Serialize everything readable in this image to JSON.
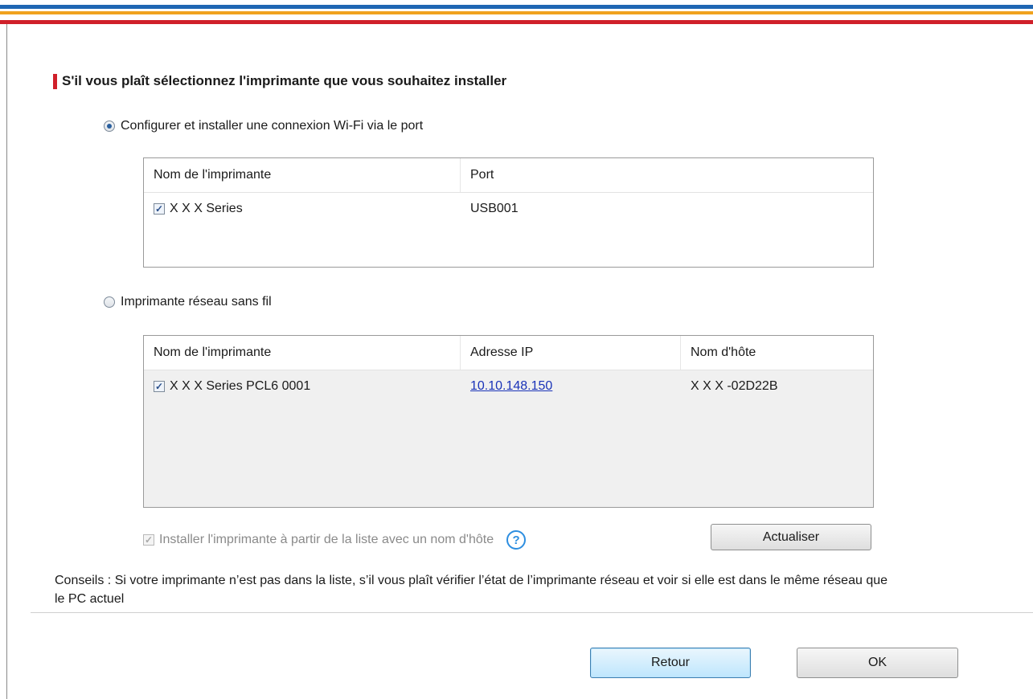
{
  "heading": "S'il vous plaît sélectionnez l'imprimante que vous souhaitez installer",
  "usb_option": {
    "label": "Configurer et installer une connexion Wi-Fi via le port",
    "selected": true,
    "columns": [
      "Nom de l'imprimante",
      "Port"
    ],
    "rows": [
      {
        "checked": true,
        "name": "X X X  Series",
        "port": "USB001"
      }
    ]
  },
  "network_option": {
    "label": "Imprimante réseau sans fil",
    "selected": false,
    "columns": [
      "Nom de l'imprimante",
      "Adresse IP",
      "Nom d'hôte"
    ],
    "rows": [
      {
        "checked": true,
        "name": "X X X  Series PCL6 0001",
        "ip": "10.10.148.150",
        "host": "X X X -02D22B"
      }
    ]
  },
  "install_by_hostname": {
    "label": "Installer l'imprimante à partir de la liste avec un nom d'hôte",
    "checked": true,
    "disabled": true
  },
  "help_icon": "?",
  "refresh_button": "Actualiser",
  "tips": "Conseils : Si votre imprimante n’est pas dans la liste, s’il vous plaît vérifier l’état de l’imprimante réseau et voir si elle est dans le même réseau que le PC actuel",
  "back_button": "Retour",
  "ok_button": "OK",
  "colors": {
    "accent_red": "#d0202a",
    "stripe_blue": "#1f66b3",
    "stripe_orange": "#f0a21e",
    "link": "#1a33b8"
  }
}
